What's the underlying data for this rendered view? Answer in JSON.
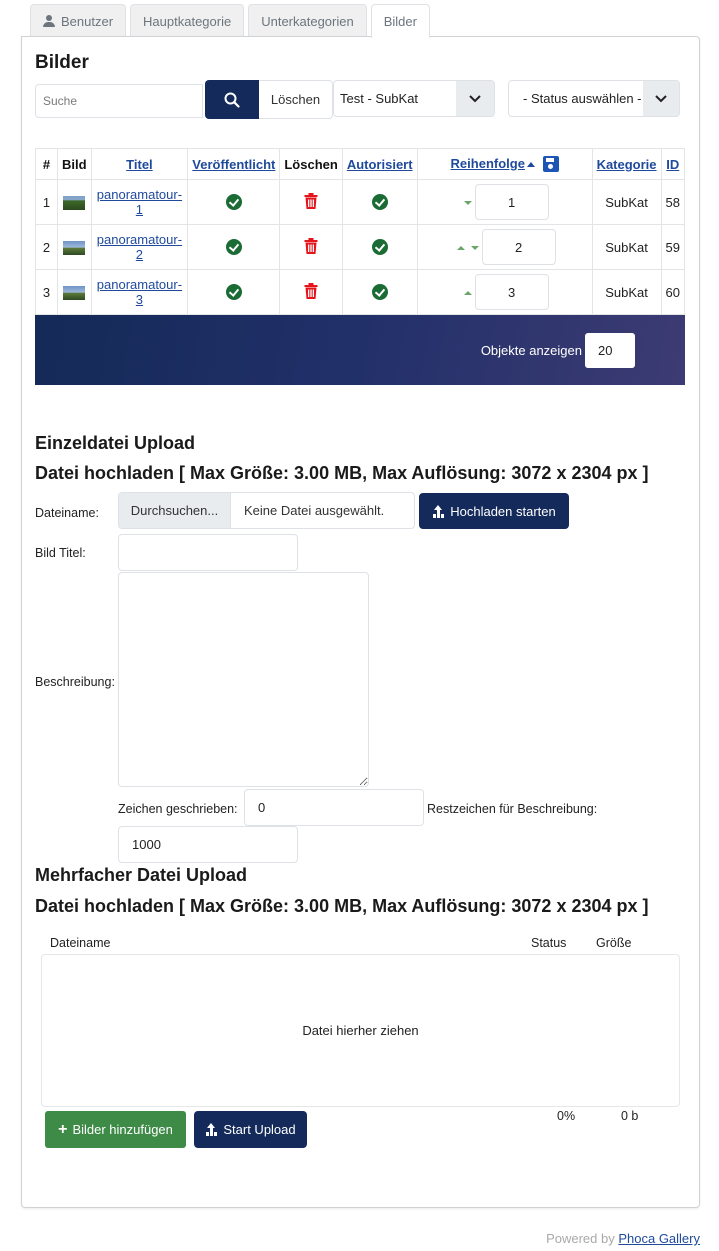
{
  "tabs": [
    {
      "label": "Benutzer",
      "icon": "user-icon",
      "active": false
    },
    {
      "label": "Hauptkategorie",
      "active": false
    },
    {
      "label": "Unterkategorien",
      "active": false
    },
    {
      "label": "Bilder",
      "active": true
    }
  ],
  "page_title": "Bilder",
  "filters": {
    "search_placeholder": "Suche",
    "search_value": "",
    "search_icon": "search-icon",
    "clear_label": "Löschen",
    "category_selected": "Test - SubKat",
    "status_selected": "- Status auswählen -"
  },
  "table": {
    "columns": {
      "num": "#",
      "image": "Bild",
      "title": "Titel",
      "published": "Veröffentlicht",
      "delete": "Löschen",
      "authorized": "Autorisiert",
      "order": "Reihenfolge",
      "category": "Kategorie",
      "id": "ID"
    },
    "rows": [
      {
        "num": "1",
        "title": "panoramatour-1",
        "published": true,
        "authorized": true,
        "order": "1",
        "category": "SubKat",
        "id": "58",
        "can_move_up": false,
        "can_move_down": true
      },
      {
        "num": "2",
        "title": "panoramatour-2",
        "published": true,
        "authorized": true,
        "order": "2",
        "category": "SubKat",
        "id": "59",
        "can_move_up": true,
        "can_move_down": true
      },
      {
        "num": "3",
        "title": "panoramatour-3",
        "published": true,
        "authorized": true,
        "order": "3",
        "category": "SubKat",
        "id": "60",
        "can_move_up": true,
        "can_move_down": false
      }
    ]
  },
  "pagination": {
    "label": "Objekte anzeigen",
    "value": "20"
  },
  "single_upload": {
    "heading": "Einzeldatei Upload",
    "subheading": "Datei hochladen [ Max Größe: 3.00 MB, Max Auflösung: 3072 x 2304 px ]",
    "filename_label": "Dateiname:",
    "browse_label": "Durchsuchen...",
    "no_file_label": "Keine Datei ausgewählt.",
    "upload_button": "Hochladen starten",
    "title_label": "Bild Titel:",
    "title_value": "",
    "description_label": "Beschreibung:",
    "description_value": "",
    "chars_written_label": "Zeichen geschrieben:",
    "chars_written_value": "0",
    "chars_remaining_label": "Restzeichen für Beschreibung:",
    "chars_remaining_value": "1000"
  },
  "multi_upload": {
    "heading": "Mehrfacher Datei Upload",
    "subheading": "Datei hochladen [ Max Größe: 3.00 MB, Max Auflösung: 3072 x 2304 px ]",
    "col_filename": "Dateiname",
    "col_status": "Status",
    "col_size": "Größe",
    "dropzone_text": "Datei hierher ziehen",
    "add_button": "Bilder hinzufügen",
    "start_button": "Start Upload",
    "total_percent": "0%",
    "total_size": "0 b"
  },
  "footer": {
    "powered_by": "Powered by",
    "link_label": "Phoca Gallery"
  },
  "colors": {
    "primary_navy": "#132a5a",
    "success_green": "#3e8a47",
    "check_green": "#1a6b34",
    "delete_red": "#e5141b",
    "link_blue": "#1f4a9c"
  }
}
